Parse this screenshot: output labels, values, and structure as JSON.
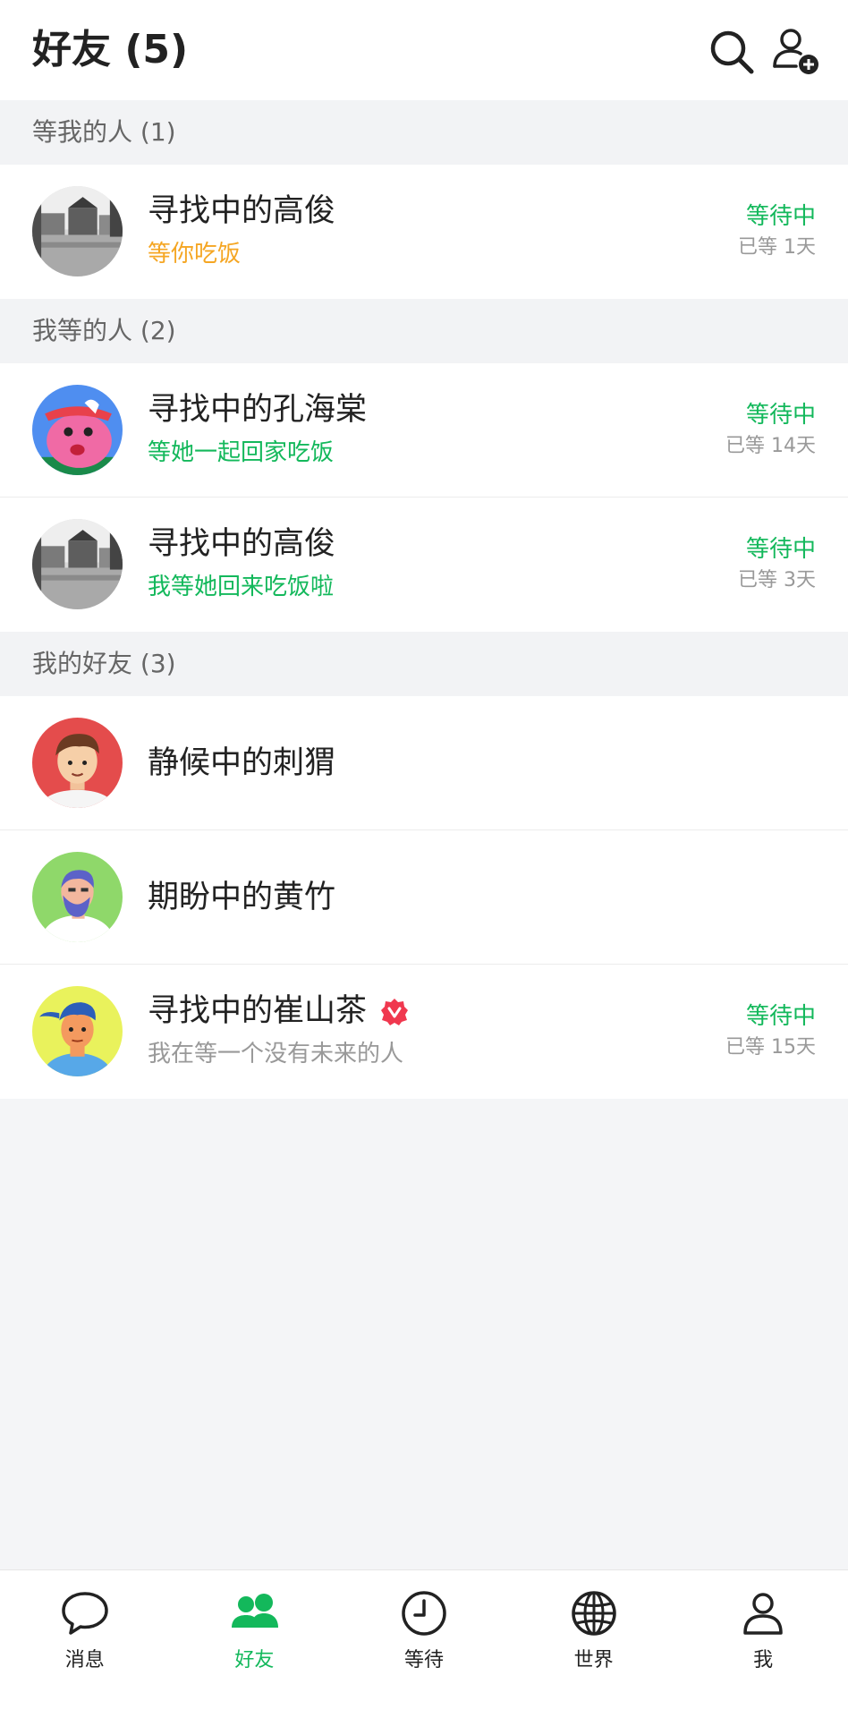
{
  "header": {
    "title": "好友 (5)",
    "icons": [
      "search-icon",
      "add-user-icon"
    ]
  },
  "sections": [
    {
      "title": "等我的人 (1)"
    },
    {
      "title": "我等的人 (2)"
    },
    {
      "title": "我的好友 (3)"
    }
  ],
  "rows": [
    {
      "name": "寻找中的高俊",
      "subtitle": "等你吃饭",
      "status": "等待中",
      "duration": "已等 1天",
      "avatar": "landscape-photo"
    },
    {
      "name": "寻找中的孔海棠",
      "subtitle": "等她一起回家吃饭",
      "status": "等待中",
      "duration": "已等 14天",
      "avatar": "cartoon-pink-character"
    },
    {
      "name": "寻找中的高俊",
      "subtitle": "我等她回来吃饭啦",
      "status": "等待中",
      "duration": "已等 3天",
      "avatar": "landscape-photo"
    },
    {
      "name": "静候中的刺猬",
      "avatar": "cartoon-boy-red-bg"
    },
    {
      "name": "期盼中的黄竹",
      "avatar": "cartoon-bearded-man-green-bg"
    },
    {
      "name": "寻找中的崔山茶",
      "subtitle": "我在等一个没有未来的人",
      "status": "等待中",
      "duration": "已等 15天",
      "avatar": "cartoon-man-yellow-bg",
      "badge": "verified-icon"
    }
  ],
  "tabs": [
    {
      "label": "消息",
      "icon": "chat-bubble-icon",
      "active": false
    },
    {
      "label": "好友",
      "icon": "friends-icon",
      "active": true
    },
    {
      "label": "等待",
      "icon": "clock-icon",
      "active": false
    },
    {
      "label": "世界",
      "icon": "globe-icon",
      "active": false
    },
    {
      "label": "我",
      "icon": "user-icon",
      "active": false
    }
  ],
  "colors": {
    "accent_green": "#13b85b",
    "accent_orange": "#f5a623",
    "verified_red": "#f0384f",
    "background": "#f4f5f7"
  }
}
